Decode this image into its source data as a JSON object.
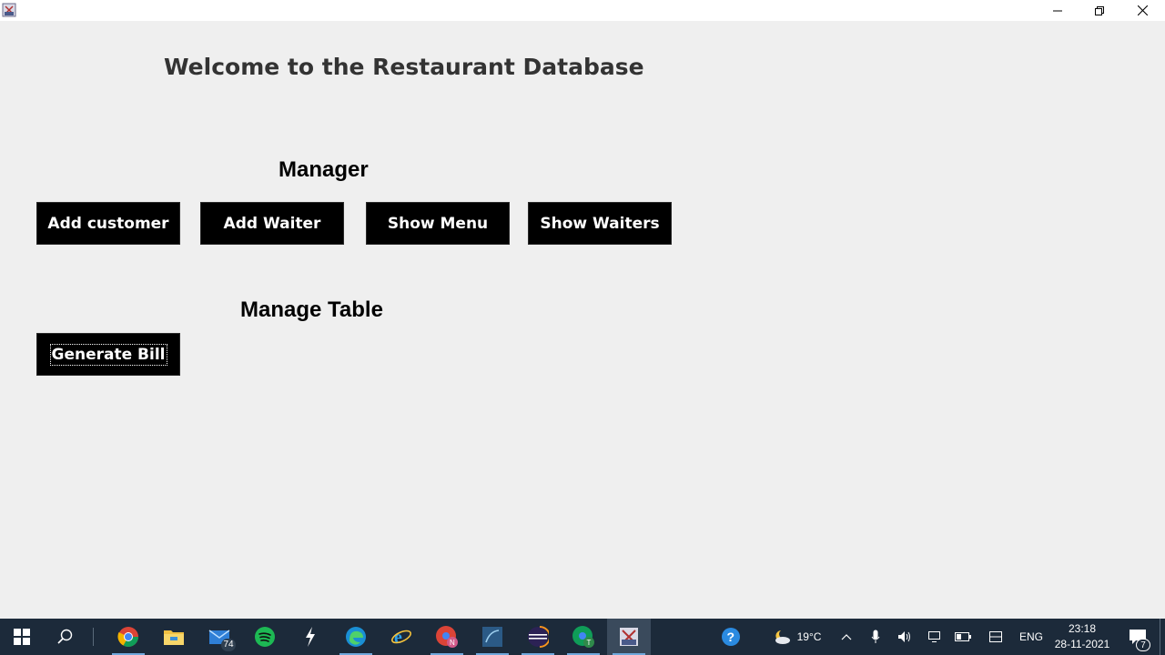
{
  "window": {
    "title": "",
    "app_icon": "java-cup-icon",
    "controls": [
      "minimize-icon",
      "maximize-icon",
      "close-icon"
    ]
  },
  "main": {
    "welcome": "Welcome to the Restaurant Database",
    "manager_heading": "Manager",
    "manager_buttons": {
      "add_customer": "Add customer",
      "add_waiter": "Add Waiter",
      "show_menu": "Show Menu",
      "show_waiters": "Show Waiters"
    },
    "manage_table_heading": "Manage Table",
    "generate_bill": "Generate Bill"
  },
  "taskbar": {
    "apps": [
      {
        "name": "chrome-icon"
      },
      {
        "name": "file-explorer-icon"
      },
      {
        "name": "mail-icon",
        "badge": "74"
      },
      {
        "name": "spotify-icon"
      },
      {
        "name": "lightning-app-icon"
      },
      {
        "name": "edge-icon"
      },
      {
        "name": "internet-explorer-icon"
      },
      {
        "name": "chrome-profile-n-icon"
      },
      {
        "name": "mysql-workbench-icon"
      },
      {
        "name": "eclipse-icon"
      },
      {
        "name": "chrome-profile-t-icon"
      },
      {
        "name": "java-app-icon"
      }
    ],
    "tray": {
      "temperature": "19°C",
      "language": "ENG",
      "time": "23:18",
      "date": "28-11-2021",
      "notifications": "7"
    }
  },
  "colors": {
    "background": "#efefef",
    "button_bg": "#000000",
    "button_text": "#ffffff",
    "taskbar": "#1c2a3a"
  }
}
